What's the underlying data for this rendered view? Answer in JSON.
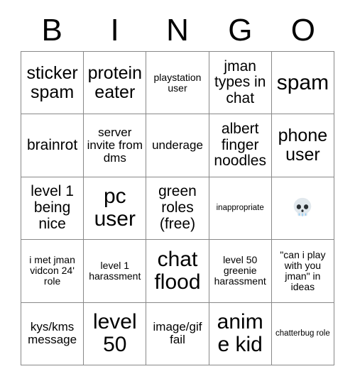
{
  "card": {
    "header_letters": [
      "B",
      "I",
      "N",
      "G",
      "O"
    ],
    "columns": 5,
    "rows": 5,
    "grid_line_color": "#888888",
    "background_color": "#ffffff",
    "text_color": "#000000",
    "cells": [
      {
        "text": "sticker spam",
        "size": "fs-lg",
        "free": false
      },
      {
        "text": "protein eater",
        "size": "fs-lg",
        "free": false
      },
      {
        "text": "playstation user",
        "size": "fs-xs",
        "free": false
      },
      {
        "text": "jman types in chat",
        "size": "fs-md",
        "free": false
      },
      {
        "text": "spam",
        "size": "fs-xl",
        "free": false
      },
      {
        "text": "brainrot",
        "size": "fs-md",
        "free": false
      },
      {
        "text": "server invite from dms",
        "size": "fs-sm",
        "free": false
      },
      {
        "text": "underage",
        "size": "fs-sm",
        "free": false
      },
      {
        "text": "albert finger noodles",
        "size": "fs-md",
        "free": false
      },
      {
        "text": "phone user",
        "size": "fs-lg",
        "free": false
      },
      {
        "text": "level 1 being nice",
        "size": "fs-md",
        "free": false
      },
      {
        "text": "pc user",
        "size": "fs-xl",
        "free": false
      },
      {
        "text": "green roles (free)",
        "size": "fs-md",
        "free": false
      },
      {
        "text": "inappropriate",
        "size": "fs-xxs",
        "free": false
      },
      {
        "text": "",
        "size": "fs-md",
        "free": true,
        "emoji": "skull"
      },
      {
        "text": "i met jman vidcon 24' role",
        "size": "fs-xs",
        "free": false
      },
      {
        "text": "level 1 harassment",
        "size": "fs-xs",
        "free": false
      },
      {
        "text": "chat flood",
        "size": "fs-xl",
        "free": false
      },
      {
        "text": "level 50 greenie harassment",
        "size": "fs-xs",
        "free": false
      },
      {
        "text": "\"can i play with you jman\" in ideas",
        "size": "fs-xs",
        "free": false
      },
      {
        "text": "kys/kms message",
        "size": "fs-sm",
        "free": false
      },
      {
        "text": "level 50",
        "size": "fs-xl",
        "free": false
      },
      {
        "text": "image/gif fail",
        "size": "fs-sm",
        "free": false
      },
      {
        "text": "anime kid",
        "size": "fs-xl",
        "free": false
      },
      {
        "text": "chatterbug role",
        "size": "fs-xxs",
        "free": false
      }
    ],
    "free_space_icon": "skull-emoji"
  }
}
